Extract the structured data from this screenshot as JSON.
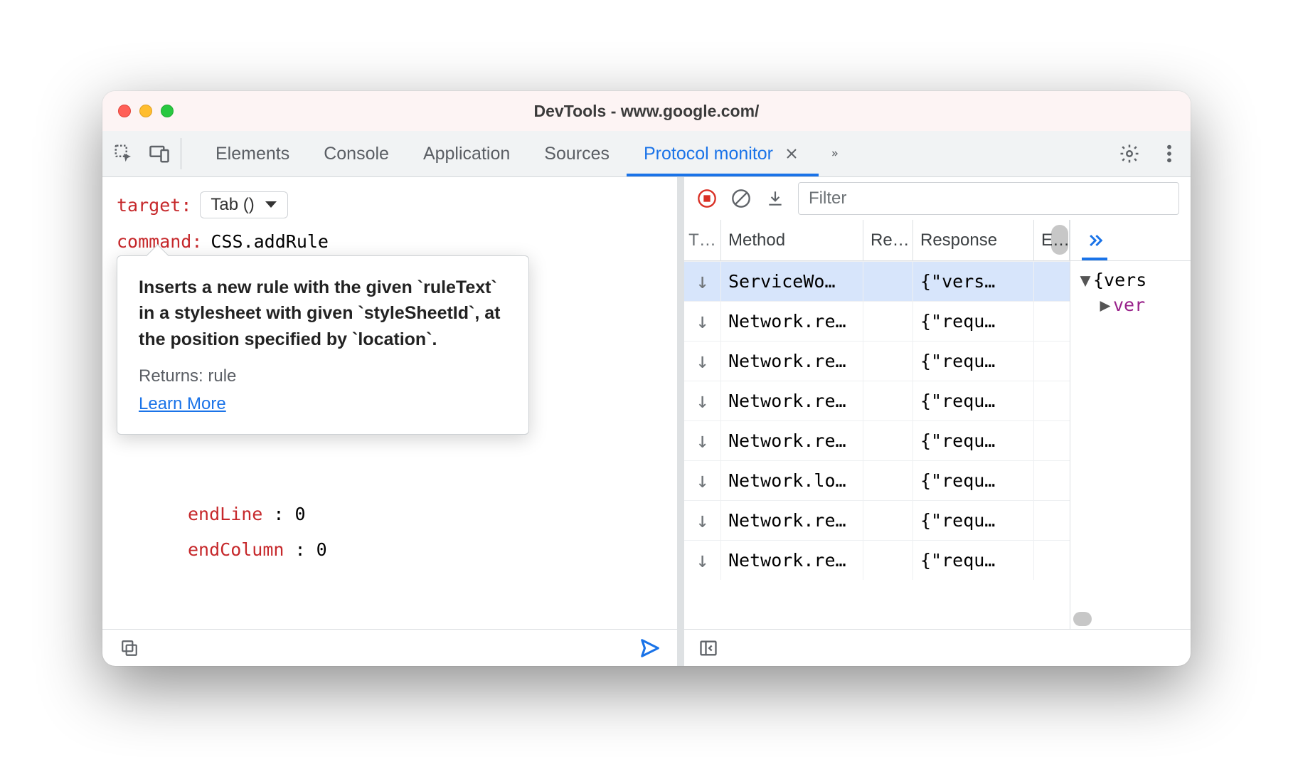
{
  "window": {
    "title": "DevTools - www.google.com/"
  },
  "tabs": {
    "items": [
      "Elements",
      "Console",
      "Application",
      "Sources",
      "Protocol monitor"
    ],
    "active_index": 4
  },
  "left": {
    "target_label": "target",
    "target_value": "Tab ()",
    "command_label": "command",
    "command_value": "CSS.addRule",
    "tooltip": {
      "description": "Inserts a new rule with the given `ruleText` in a stylesheet with given `styleSheetId`, at the position specified by `location`.",
      "returns": "Returns: rule",
      "learn_more": "Learn More"
    },
    "params": {
      "endLine_key": "endLine",
      "endLine_val": "0",
      "endColumn_key": "endColumn",
      "endColumn_val": "0"
    }
  },
  "right": {
    "filter_placeholder": "Filter",
    "columns": {
      "type": "T…",
      "method": "Method",
      "req": "Re…",
      "resp": "Response",
      "e": "E…"
    },
    "rows": [
      {
        "method": "ServiceWo…",
        "resp": "{\"vers…",
        "selected": true
      },
      {
        "method": "Network.re…",
        "resp": "{\"requ…"
      },
      {
        "method": "Network.re…",
        "resp": "{\"requ…"
      },
      {
        "method": "Network.re…",
        "resp": "{\"requ…"
      },
      {
        "method": "Network.re…",
        "resp": "{\"requ…"
      },
      {
        "method": "Network.lo…",
        "resp": "{\"requ…"
      },
      {
        "method": "Network.re…",
        "resp": "{\"requ…"
      },
      {
        "method": "Network.re…",
        "resp": "{\"requ…"
      }
    ],
    "detail_tab": "≫",
    "detail": {
      "root": "{vers",
      "child": "ver"
    }
  }
}
